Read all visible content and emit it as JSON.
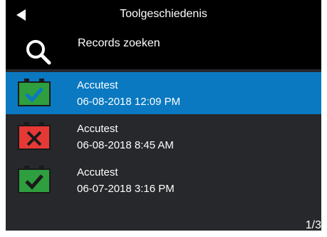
{
  "header": {
    "title": "Toolgeschiedenis"
  },
  "search": {
    "label": "Records zoeken"
  },
  "records": [
    {
      "name": "Accutest",
      "datetime": "06-08-2018  12:09 PM",
      "status": "pass",
      "selected": true
    },
    {
      "name": "Accutest",
      "datetime": "06-08-2018  8:45 AM",
      "status": "fail",
      "selected": false
    },
    {
      "name": "Accutest",
      "datetime": "06-07-2018  3:16 PM",
      "status": "pass",
      "selected": false
    }
  ],
  "pager": {
    "text": "1/3"
  },
  "colors": {
    "background": "#26282b",
    "header": "#000000",
    "selected": "#0a79c1",
    "pass": "#2e9e3f",
    "fail": "#e53935"
  }
}
